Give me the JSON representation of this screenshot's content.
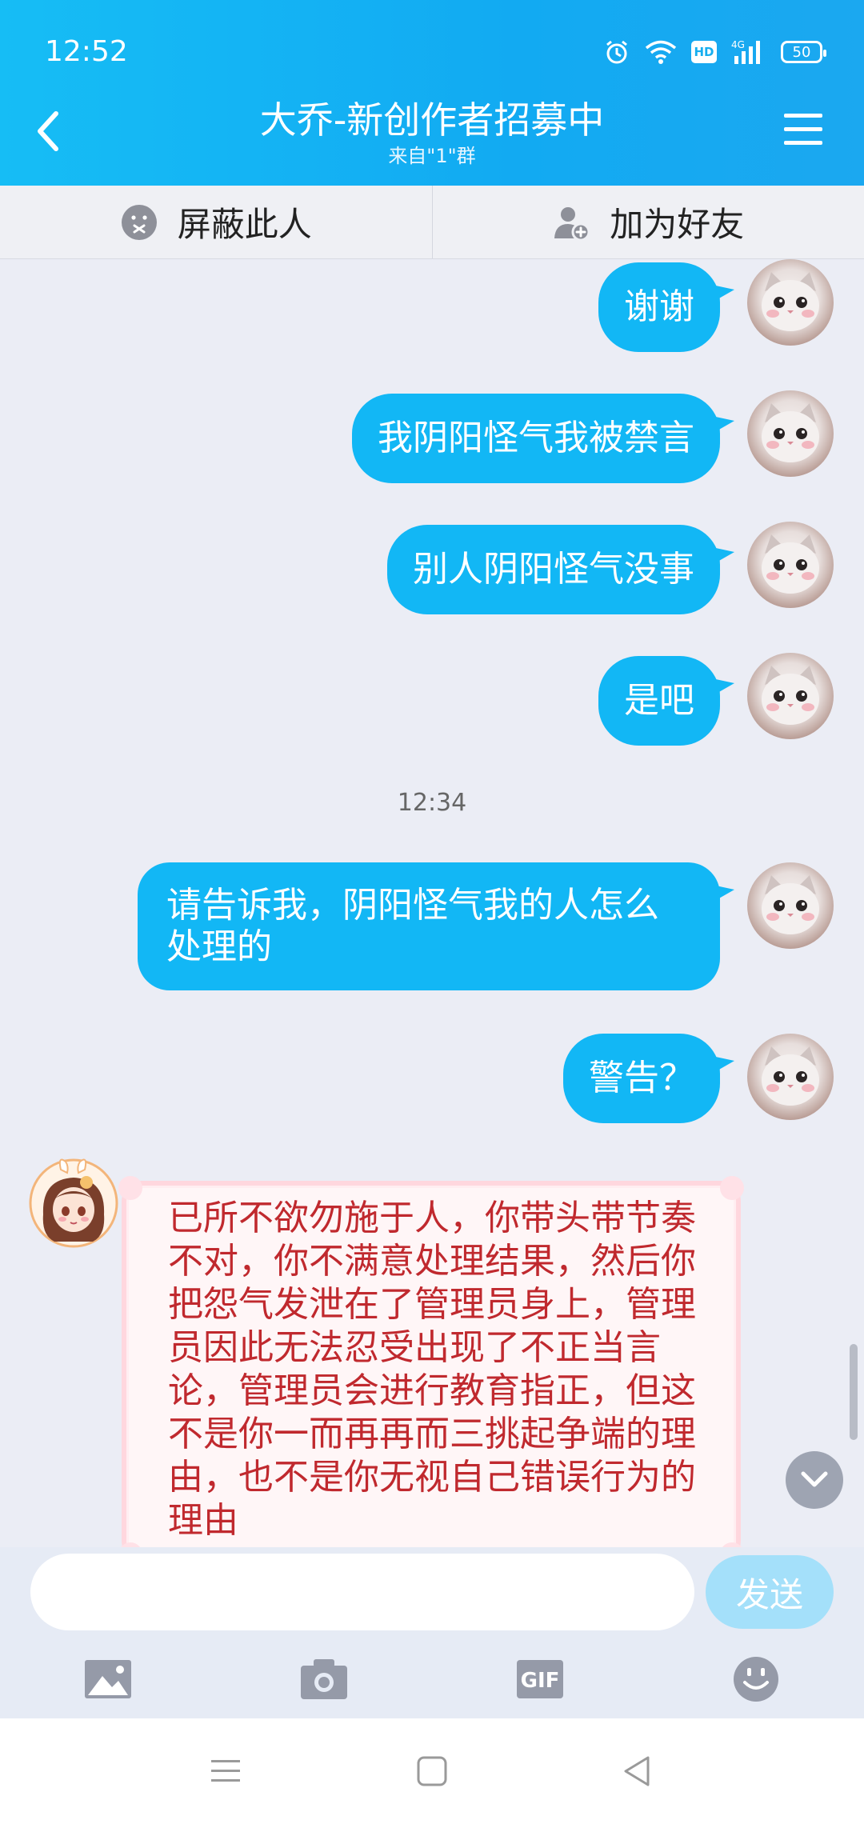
{
  "status_bar": {
    "time": "12:52",
    "network": "4G",
    "hd": "HD",
    "battery": "50"
  },
  "header": {
    "title": "大乔-新创作者招募中",
    "subtitle": "来自\"1\"群"
  },
  "actions": {
    "block_label": "屏蔽此人",
    "add_friend_label": "加为好友"
  },
  "messages": [
    {
      "text": "谢谢"
    },
    {
      "text": "我阴阳怪气我被禁言"
    },
    {
      "text": "别人阴阳怪气没事"
    },
    {
      "text": "是吧"
    },
    {
      "text": "请告诉我，阴阳怪气我的人怎么处理的"
    },
    {
      "text": "警告？"
    }
  ],
  "timestamp": "12:34",
  "incoming": {
    "text": "已所不欲勿施于人，你带头带节奏不对，你不满意处理结果，然后你把怨气发泄在了管理员身上，管理员因此无法忍受出现了不正当言论，管理员会进行教育指正，但这不是你一而再再而三挑起争端的理由，也不是你无视自己错误行为的理由"
  },
  "input": {
    "placeholder": "",
    "send_label": "发送"
  },
  "tools": {
    "gif_label": "GIF"
  }
}
